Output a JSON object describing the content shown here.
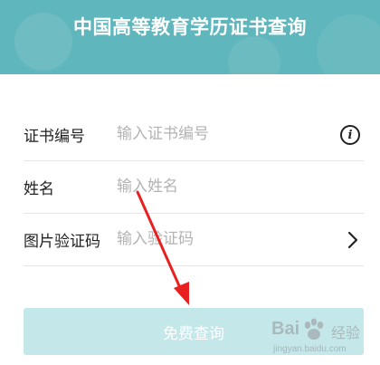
{
  "header": {
    "title": "中国高等教育学历证书查询",
    "color": "#5fb6bc"
  },
  "form": {
    "rows": [
      {
        "label": "证书编号",
        "placeholder": "输入证书编号",
        "value": "",
        "trailing_icon": "info-icon"
      },
      {
        "label": "姓名",
        "placeholder": "输入姓名",
        "value": ""
      },
      {
        "label": "图片验证码",
        "placeholder": "输入验证码",
        "value": "",
        "trailing_icon": "chevron-right-icon"
      }
    ]
  },
  "submit": {
    "label": "免费查询",
    "color": "#c4e7ea"
  },
  "annotation": {
    "arrow_color": "#e8201f"
  },
  "watermark": {
    "brand": "Bai",
    "suffix": "经验",
    "url": "jingyan.baidu.com"
  }
}
